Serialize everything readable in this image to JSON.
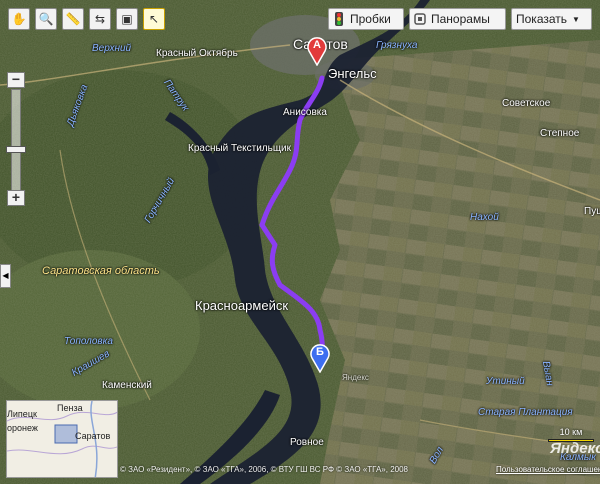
{
  "toolbar": {
    "tools": [
      {
        "name": "hand-tool",
        "glyph": "✋"
      },
      {
        "name": "zoom-area-tool",
        "glyph": "🔍"
      },
      {
        "name": "ruler-tool",
        "glyph": "📏"
      },
      {
        "name": "route-tool",
        "glyph": "⇆"
      },
      {
        "name": "screen-tool",
        "glyph": "▣"
      },
      {
        "name": "pointer-tool",
        "glyph": "↖"
      }
    ],
    "traffic_label": "Пробки",
    "panoramas_label": "Панорамы",
    "show_label": "Показать",
    "show_arrow": "▼"
  },
  "zoom": {
    "plus": "+",
    "minus": "−"
  },
  "side_tab_arrow": "◀",
  "labels": {
    "saratov": "Саратов",
    "engels": "Энгельс",
    "gryaznukha": "Грязнуха",
    "verkhniy": "Верхний",
    "krasny_oktyabr": "Красный Октябрь",
    "anisovka": "Анисовка",
    "krasny_tekstilshchik": "Красный Текстильщик",
    "patruk": "Патрук",
    "dyakovka": "Дьяковка",
    "gorchichny": "Горчичный",
    "saratov_region": "Саратовская область",
    "krasnoarmeysk": "Красноармейск",
    "toplovka": "Тополовка",
    "kramysh": "Краишев",
    "kamensky": "Каменский",
    "sovetskoe": "Советское",
    "stepnoe": "Степное",
    "nakhoy": "Нахой",
    "pushk": "Пушк",
    "utiny": "Утиный",
    "staraya_plantatsiya": "Старая Плантация",
    "rovnoe": "Ровное",
    "kalmyk": "Калмык",
    "vyan": "Выан",
    "vol": "Вол",
    "yandex_small": "Яндекс"
  },
  "markers": {
    "a": "А",
    "b": "Б"
  },
  "minimap": {
    "penza": "Пенза",
    "voronezh": "оронеж",
    "lipetsk": "Липецк",
    "saratov": "Саратов"
  },
  "scale": "10 км",
  "copyright": "© ЗАО «Резидент», © ЗАО «ТГА», 2006, © ВТУ ГШ ВС РФ © ЗАО «ТГА», 2008",
  "terms": "Пользовательское соглашение",
  "brand": "Яндекс",
  "colors": {
    "route": "#8b3df2",
    "marker_a": "#e23b3b",
    "marker_b": "#3d6ef0",
    "river": "#1a2130"
  }
}
